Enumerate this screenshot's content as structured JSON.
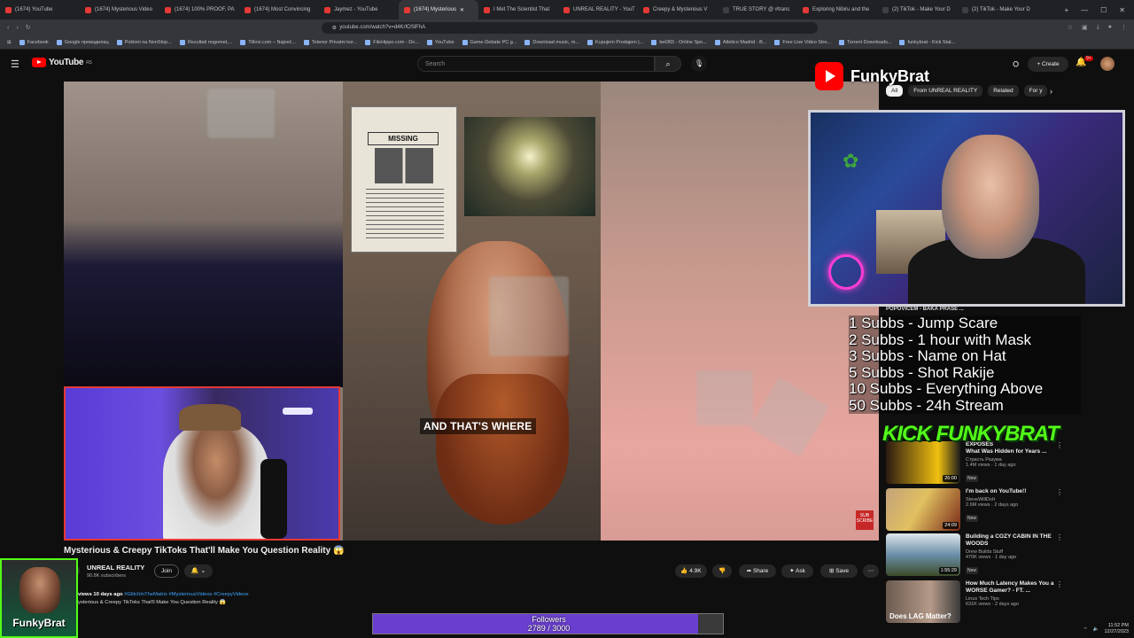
{
  "browser": {
    "tabs": [
      {
        "label": "(1674) YouTube",
        "active": false
      },
      {
        "label": "(1674) Mysterious Video",
        "active": false
      },
      {
        "label": "(1674) 100% PROOF, PA",
        "active": false
      },
      {
        "label": "(1674) Most Convincing",
        "active": false
      },
      {
        "label": "Jaymez - YouTube",
        "active": false
      },
      {
        "label": "(1674) Mysterious",
        "active": true
      },
      {
        "label": "I Met The Scientist That",
        "active": false
      },
      {
        "label": "UNREAL REALITY - YouT",
        "active": false
      },
      {
        "label": "Creepy & Mysterious V",
        "active": false
      },
      {
        "label": "TRUE STORY @ #tranc",
        "active": false
      },
      {
        "label": "Exploring Nibiru and the",
        "active": false
      },
      {
        "label": "(2) TikTok - Make Your D",
        "active": false
      },
      {
        "label": "(2) TikTok - Make Your D",
        "active": false
      }
    ],
    "url": "youtube.com/watch?v=d4KrfOSlFhA",
    "bookmarks": [
      "Facebook",
      "Google преводилац",
      "Pokloni na NonStop...",
      "Rezultati nogomet,...",
      "Titlovi.com – Najveć...",
      "Telenor Privatni kor...",
      "FileHippo.com - Do...",
      "YouTube",
      "Game-Debate PC g...",
      "Download music, m...",
      "Kupujem Prodajem |...",
      "bet365 - Online Spo...",
      "Atletico Madrid - B...",
      "Free Live Video Stre...",
      "Torrent Downloads...",
      "funkybrat - Kick Stat..."
    ]
  },
  "youtube": {
    "logo_text": "YouTube",
    "region": "RS",
    "search_placeholder": "Search",
    "create_label": "Create",
    "notif_count": "9+"
  },
  "stream": {
    "channel_name": "FunkyBrat",
    "rules": [
      "1 Subbs - Jump Scare",
      "2 Subbs - 1 hour with Mask",
      "3 Subbs - Name on Hat",
      "5 Subbs - Shot Rakije",
      "10 Subbs - Everything Above",
      "50 Subbs - 24h Stream"
    ],
    "kick_banner": "KICK FUNKYBRAT",
    "followers_label": "Followers",
    "followers_current": 2789,
    "followers_goal": 3000,
    "followers_text": "2789 / 3000",
    "badge_name": "FunkyBrat",
    "subscribe_watermark": "SUB SCRIBE"
  },
  "video": {
    "caption": "AND THAT'S WHERE",
    "milk_title": "MISSING",
    "title": "Mysterious & Creepy TikToks That'll Make You Question Reality 😱",
    "channel": "UNREAL REALITY",
    "subscribers": "90.8K subscribers",
    "join_label": "Join",
    "likes": "4.9K",
    "share_label": "Share",
    "ask_label": "Ask",
    "save_label": "Save",
    "desc_meta": "views  10 days ago",
    "desc_tags": "#GlitchInTheMatrix #MysteriousVideos #CreepyVideos",
    "desc_line2": "ysterious & Creepy TikToks That'll Make You Question Reality 😱"
  },
  "sidebar": {
    "chips": [
      "All",
      "From UNREAL REALITY",
      "Related",
      "For y"
    ],
    "teaser": "POPOVIĆEM - BAKA PRASE ...",
    "items": [
      {
        "title": "What Was Hidden for Years ...",
        "title_pre": "EXPOSES",
        "channel": "Страсть Разума",
        "meta": "1.4M views · 1 day ago",
        "badge": "New",
        "duration": "26:00"
      },
      {
        "title": "I'm back on YouTube!!",
        "channel": "SteveWillDoIt",
        "meta": "2.6M views · 2 days ago",
        "badge": "New",
        "duration": "24:09"
      },
      {
        "title": "Building a COZY CABIN IN THE WOODS",
        "channel": "Drew Builds Stuff",
        "meta": "470K views · 1 day ago",
        "badge": "New",
        "duration": "1:55:29"
      },
      {
        "title": "How Much Latency Makes You a WORSE Gamer? - FT. ...",
        "channel": "Linus Tech Tips",
        "meta": "631K views · 2 days ago",
        "badge": "",
        "duration": "Does LAG Matter?"
      }
    ]
  },
  "system": {
    "time": "11:52 PM",
    "date": "12/27/2023"
  },
  "colors": {
    "youtube_red": "#ff0000",
    "kick_green": "#53fc18",
    "followers_fill": "#6a3fcf"
  }
}
